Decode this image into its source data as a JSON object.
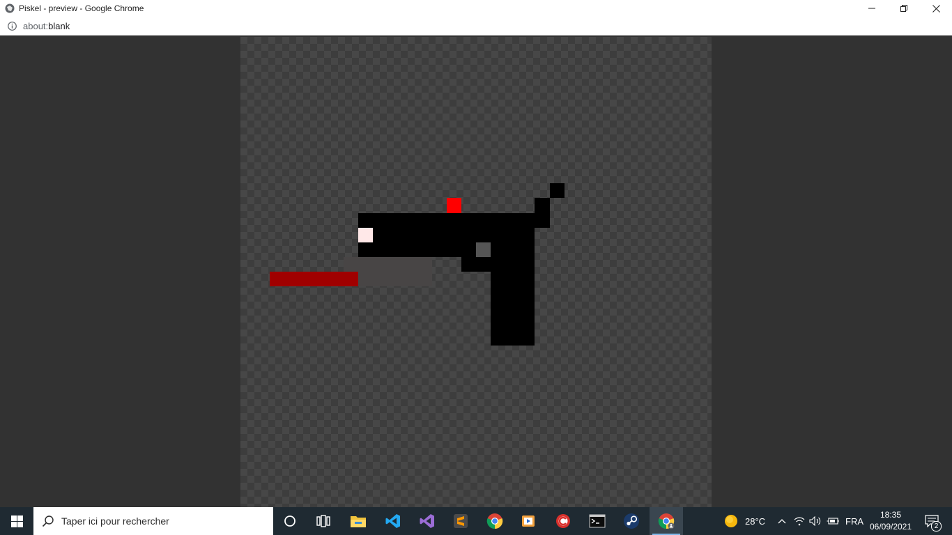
{
  "window": {
    "title": "Piskel - preview - Google Chrome",
    "controls": [
      "minimize",
      "restore",
      "close"
    ]
  },
  "address_bar": {
    "scheme": "about:",
    "path": "blank"
  },
  "canvas": {
    "content": "pixel-art-pistol",
    "colors": {
      "body": "#000000",
      "sight": "#ff0000",
      "muzzle_flash": "#ffe8e8",
      "shadow": "#484545",
      "laser": "#a00000",
      "hole": "#555555"
    }
  },
  "taskbar": {
    "search_placeholder": "Taper ici pour rechercher",
    "apps": [
      {
        "name": "cortana",
        "icon": "circle-icon"
      },
      {
        "name": "task-view",
        "icon": "task-view-icon"
      },
      {
        "name": "file-explorer",
        "icon": "folder-icon"
      },
      {
        "name": "vs-code",
        "icon": "vscode-icon"
      },
      {
        "name": "visual-studio",
        "icon": "visual-studio-icon"
      },
      {
        "name": "sublime-text",
        "icon": "sublime-icon"
      },
      {
        "name": "google-chrome",
        "icon": "chrome-icon"
      },
      {
        "name": "media-player",
        "icon": "media-player-icon"
      },
      {
        "name": "ccleaner",
        "icon": "ccleaner-icon"
      },
      {
        "name": "terminal",
        "icon": "terminal-icon"
      },
      {
        "name": "steam",
        "icon": "steam-icon"
      },
      {
        "name": "chrome-piskel",
        "icon": "chrome-icon",
        "active": true
      }
    ],
    "weather": "28°C",
    "language": "FRA",
    "time": "18:35",
    "date": "06/09/2021",
    "notifications": "2"
  }
}
